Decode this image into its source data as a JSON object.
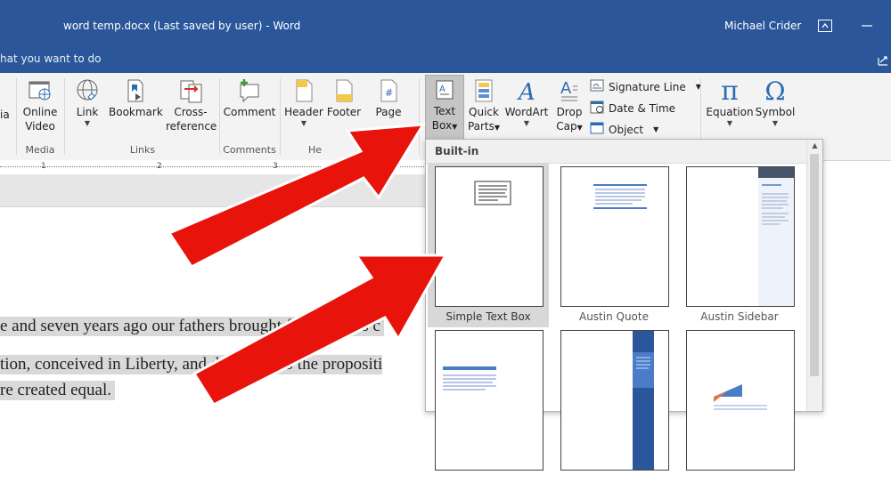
{
  "titlebar": {
    "title": "word temp.docx (Last saved by user)  -  Word",
    "user": "Michael Crider",
    "icons": [
      "ribbon-display-icon",
      "minimize-icon"
    ]
  },
  "tellme": {
    "text": "hat you want to do"
  },
  "ribbon": {
    "partial_label": "ia",
    "media": {
      "online_video": "Online Video",
      "label": "Media"
    },
    "links": {
      "link": "Link",
      "bookmark": "Bookmark",
      "cross_reference": "Cross-reference",
      "label": "Links"
    },
    "comments": {
      "comment": "Comment",
      "label": "Comments"
    },
    "header_footer": {
      "header": "Header",
      "footer": "Footer",
      "page": "Page",
      "label": "He"
    },
    "text": {
      "text_box": "Text Box",
      "quick_parts": "Quick Parts",
      "wordart": "WordArt",
      "drop_cap": "Drop Cap",
      "signature_line": "Signature Line",
      "date_time": "Date & Time",
      "object": "Object"
    },
    "symbols": {
      "equation": "Equation",
      "symbol": "Symbol"
    }
  },
  "ruler": {
    "marks": [
      "1",
      "2",
      "3"
    ]
  },
  "document": {
    "lines": [
      "e and seven years ago our fathers brought forth on this c",
      "tion, conceived in Liberty, and dedicated to the propositi",
      "re created equal."
    ]
  },
  "gallery": {
    "header": "Built-in",
    "items": [
      {
        "label": "Simple Text Box",
        "selected": true
      },
      {
        "label": "Austin Quote",
        "selected": false
      },
      {
        "label": "Austin Sidebar",
        "selected": false
      },
      {
        "label": "",
        "selected": false
      },
      {
        "label": "",
        "selected": false
      },
      {
        "label": "",
        "selected": false
      }
    ]
  },
  "colors": {
    "accent": "#2b579a",
    "arrow": "#e8140c"
  }
}
